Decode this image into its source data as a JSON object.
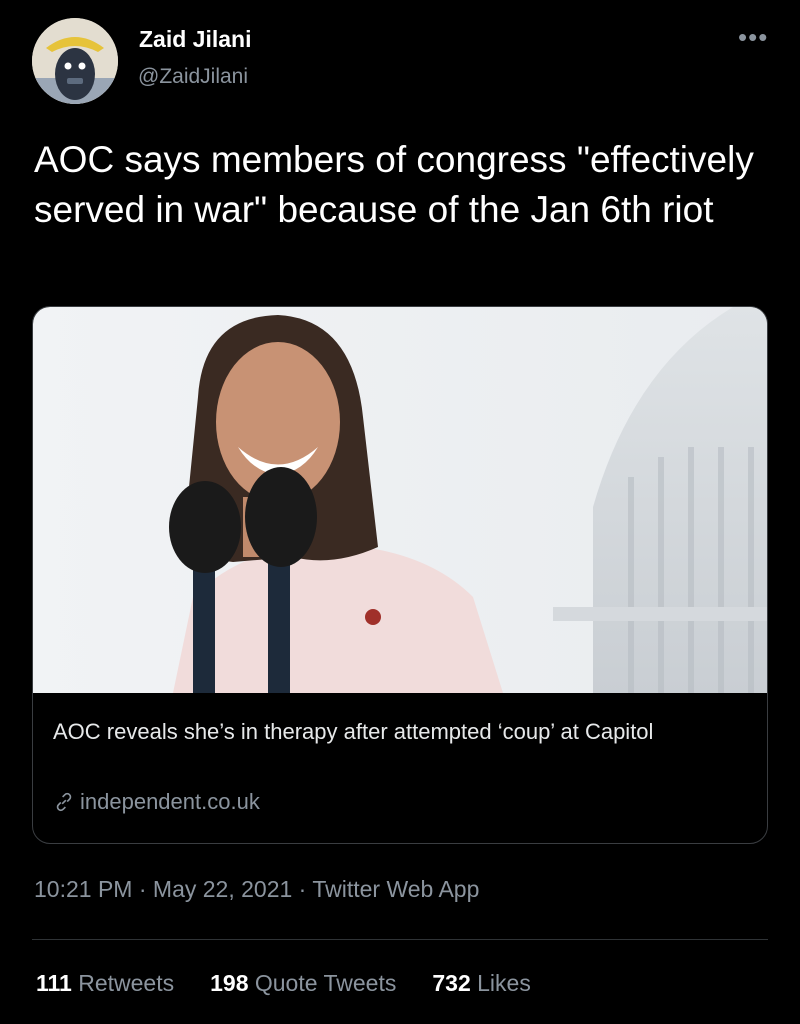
{
  "author": {
    "name": "Zaid Jilani",
    "handle": "@ZaidJilani",
    "more_icon": "ellipsis-icon"
  },
  "tweet": {
    "text": "AOC says members of congress \"effectively served in war\" because of the Jan 6th riot"
  },
  "link_card": {
    "title": "AOC reveals she’s in therapy after attempted ‘coup’ at Capitol",
    "domain": "independent.co.uk",
    "link_icon": "link-icon"
  },
  "meta": {
    "time": "10:21 PM",
    "separator": "·",
    "date": "May 22, 2021",
    "source": "Twitter Web App"
  },
  "stats": {
    "retweets_count": "111",
    "retweets_label": "Retweets",
    "quotes_count": "198",
    "quotes_label": "Quote Tweets",
    "likes_count": "732",
    "likes_label": "Likes"
  }
}
